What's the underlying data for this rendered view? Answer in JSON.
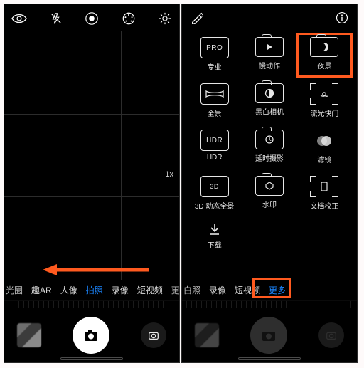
{
  "left": {
    "zoom": "1x",
    "modes": {
      "m0": "光圈",
      "m1": "趣AR",
      "m2": "人像",
      "m3": "拍照",
      "m4": "录像",
      "m5": "短视频",
      "m6": "更"
    }
  },
  "right": {
    "tiles": {
      "pro": {
        "label": "专业",
        "badge": "PRO"
      },
      "slowmo": {
        "label": "慢动作"
      },
      "night": {
        "label": "夜景"
      },
      "pano": {
        "label": "全景"
      },
      "mono": {
        "label": "黑白相机"
      },
      "lightpaint": {
        "label": "流光快门"
      },
      "hdr": {
        "label": "HDR",
        "badge": "HDR"
      },
      "timelapse": {
        "label": "延时摄影"
      },
      "filter": {
        "label": "滤镜"
      },
      "pano3d": {
        "label": "3D 动态全景"
      },
      "watermark": {
        "label": "水印"
      },
      "docscan": {
        "label": "文档校正"
      },
      "download": {
        "label": "下载"
      }
    },
    "modes": {
      "m0": "白照",
      "m1": "录像",
      "m2": "短视频",
      "m3": "更多"
    }
  }
}
